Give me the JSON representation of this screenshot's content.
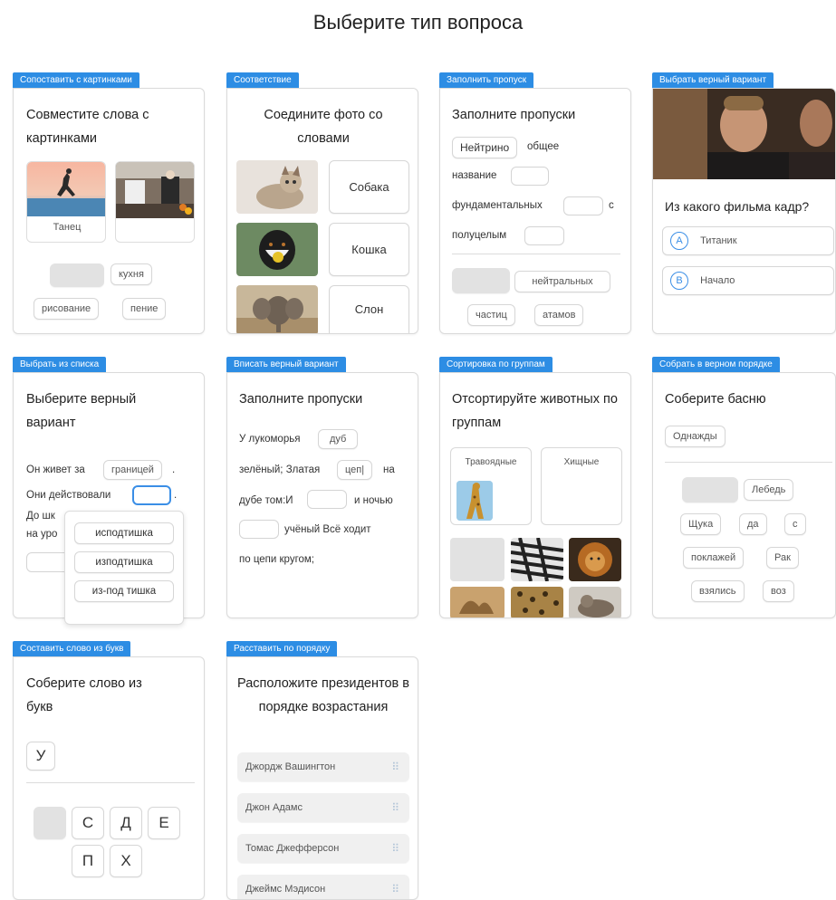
{
  "page": {
    "title": "Выберите тип вопроса"
  },
  "cards": {
    "c1": {
      "tag": "Сопоставить с картинками",
      "question": "Совместите слова с картинками",
      "caption": "Танец",
      "chips": [
        "кухня",
        "рисование",
        "пение"
      ]
    },
    "c2": {
      "tag": "Соответствие",
      "question": "Соедините фото со словами",
      "words": [
        "Собака",
        "Кошка",
        "Слон"
      ]
    },
    "c3": {
      "tag": "Заполнить пропуск",
      "question": "Заполните пропуски",
      "filled": "Нейтрино",
      "t1": "общее",
      "t2": "название",
      "t3": "фундаментальных",
      "t4": "с",
      "t5": "полуцелым",
      "chips": [
        "нейтральных",
        "частиц",
        "атамов"
      ]
    },
    "c4": {
      "tag": "Выбрать верный вариант",
      "question": "Из какого фильма кадр?",
      "options": [
        {
          "letter": "A",
          "text": "Титаник"
        },
        {
          "letter": "B",
          "text": "Начало"
        }
      ]
    },
    "c5": {
      "tag": "Выбрать из списка",
      "question": "Выберите верный вариант",
      "l1": "Он живет за",
      "l1_value": "границей",
      "l1_end": ".",
      "l2": "Они действовали",
      "l2_end": ".",
      "l3": "До шк",
      "l4": "на уро",
      "dropdown": [
        "исподтишка",
        "изподтишка",
        "из-под тишка"
      ]
    },
    "c6": {
      "tag": "Вписать верный вариант",
      "question": "Заполните пропуски",
      "t1": "У лукоморья",
      "v1": "дуб",
      "t2": "зелёный; Златая",
      "v2": "цеп|",
      "t3": "на",
      "t4": "дубе том:И",
      "t5": "и ночью",
      "t6": "учёный Всё ходит",
      "t7": "по цепи кругом;"
    },
    "c7": {
      "tag": "Сортировка по группам",
      "question": "Отсортируйте животных по группам",
      "groups": [
        "Травоядные",
        "Хищные"
      ]
    },
    "c8": {
      "tag": "Собрать в верном порядке",
      "question": "Соберите басню",
      "placed": "Однажды",
      "chips": [
        "Лебедь",
        "Щука",
        "да",
        "с",
        "поклажей",
        "Рак",
        "взялись",
        "воз"
      ]
    },
    "c9": {
      "tag": "Составить слово из букв",
      "question": "Соберите слово из букв",
      "placed": "У",
      "letters": [
        "С",
        "Д",
        "Е",
        "П",
        "Х"
      ]
    },
    "c10": {
      "tag": "Расставить по порядку",
      "question": "Расположите президентов в порядке возрастания",
      "items": [
        "Джордж Вашингтон",
        "Джон Адамс",
        "Томас Джефферсон",
        "Джеймс Мэдисон"
      ]
    }
  },
  "icons": {
    "drag": "drag-handle-icon"
  },
  "colors": {
    "accent": "#2d8de4",
    "focus": "#3a8ee6"
  }
}
